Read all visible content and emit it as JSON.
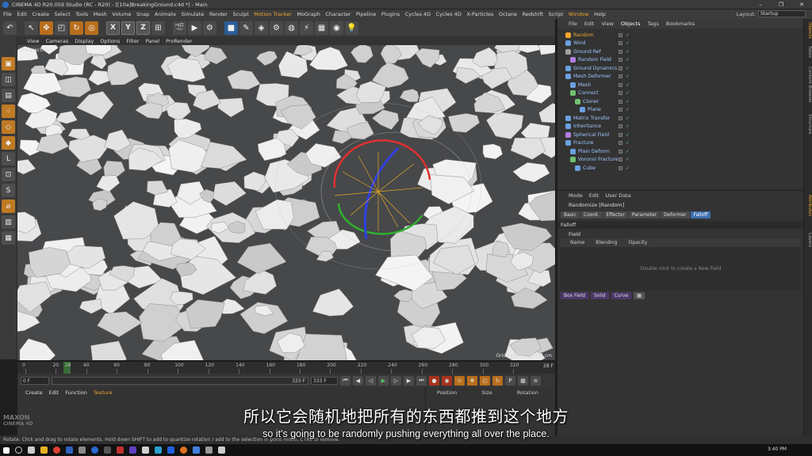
{
  "window": {
    "title": "CINEMA 4D R20.059 Studio (RC - R20) - [[10a]BreakingGround.c4d *] - Main",
    "controls": [
      "–",
      "❐",
      "✕"
    ]
  },
  "menubar": {
    "items": [
      "File",
      "Edit",
      "Create",
      "Select",
      "Tools",
      "Mesh",
      "Volume",
      "Snap",
      "Animate",
      "Simulate",
      "Render",
      "Sculpt",
      "Motion Tracker",
      "MoGraph",
      "Character",
      "Pipeline",
      "Plugins",
      "Cycles 4D",
      "Cycles 4D",
      "X-Particles",
      "Octane",
      "Redshift",
      "Script",
      "Window",
      "Help"
    ],
    "highlighted": [
      "Motion Tracker",
      "Window"
    ],
    "layout_label": "Layout:",
    "layout_value": "Startup"
  },
  "toolbar": {
    "axis_letters": [
      "X",
      "Y",
      "Z"
    ]
  },
  "viewport": {
    "menu": [
      "View",
      "Cameras",
      "Display",
      "Options",
      "Filter",
      "Panel",
      "ProRender"
    ],
    "projection": "Perspective",
    "grid_spacing": "Grid Spacing : 1000 cm"
  },
  "timeline": {
    "ticks": [
      "0",
      "20",
      "28",
      "40",
      "60",
      "80",
      "100",
      "120",
      "140",
      "160",
      "180",
      "200",
      "220",
      "240",
      "260",
      "280",
      "300",
      "320"
    ],
    "end_frame": "28 F",
    "current_frame": "0 F",
    "start_field": "0 F",
    "preview_end": "333 F",
    "end_field": "333 F"
  },
  "material_panel": {
    "menu": [
      "Create",
      "Edit",
      "Function",
      "Texture"
    ],
    "active": "Texture"
  },
  "coord_panel": {
    "headers": [
      "Position",
      "Size",
      "Rotation"
    ]
  },
  "object_manager": {
    "menu": [
      "File",
      "Edit",
      "View",
      "Objects",
      "Tags",
      "Bookmarks"
    ],
    "active_menu": "Objects",
    "objects": [
      {
        "name": "Random",
        "indent": 1,
        "color": "#f0a530",
        "selected": true
      },
      {
        "name": "Wind",
        "indent": 1,
        "color": "#6aa0e0"
      },
      {
        "name": "Ground Ref",
        "indent": 1,
        "color": "#a0a0a0"
      },
      {
        "name": "Random Field",
        "indent": 2,
        "color": "#b080e0"
      },
      {
        "name": "Ground Dynamics",
        "indent": 1,
        "color": "#6aa0e0"
      },
      {
        "name": "Mesh Deformer",
        "indent": 1,
        "color": "#6aa0e0"
      },
      {
        "name": "Mesh",
        "indent": 2,
        "color": "#6aa0e0"
      },
      {
        "name": "Connect",
        "indent": 2,
        "color": "#70c070"
      },
      {
        "name": "Cloner",
        "indent": 3,
        "color": "#70c070"
      },
      {
        "name": "Plane",
        "indent": 4,
        "color": "#6aa0e0"
      },
      {
        "name": "Matrix Transfer",
        "indent": 1,
        "color": "#6aa0e0"
      },
      {
        "name": "Inheritance",
        "indent": 1,
        "color": "#6aa0e0"
      },
      {
        "name": "Spherical Field",
        "indent": 1,
        "color": "#b080e0"
      },
      {
        "name": "Fracture",
        "indent": 1,
        "color": "#6aa0e0"
      },
      {
        "name": "Plain Deform",
        "indent": 2,
        "color": "#6aa0e0"
      },
      {
        "name": "Voronoi Fracture",
        "indent": 2,
        "color": "#70c070"
      },
      {
        "name": "Cube",
        "indent": 3,
        "color": "#6aa0e0"
      }
    ]
  },
  "attribute_manager": {
    "menu": [
      "Mode",
      "Edit",
      "User Data"
    ],
    "title": "Randomize [Random]",
    "tabs": [
      "Basic",
      "Coord.",
      "Effector",
      "Parameter",
      "Deformer",
      "Falloff"
    ],
    "active_tab": "Falloff",
    "section": "Falloff",
    "field_label": "Field",
    "columns": [
      "Name",
      "Blending",
      "Opacity"
    ],
    "empty_hint": "Double click to create a New Field",
    "buttons": [
      "Box Field",
      "Solid",
      "Curve"
    ]
  },
  "right_strip": [
    "Objects",
    "Takes",
    "Content Browser",
    "Structure",
    "Attributes",
    "Layers"
  ],
  "status": "Rotate: Click and drag to rotate elements. Hold down SHIFT to add to quantize rotation / add to the selection in point mode, CTRL to remove.",
  "subtitle": {
    "zh": "所以它会随机地把所有的东西都推到这个地方",
    "en": "so it's going to be randomly pushing everything all over the place."
  },
  "taskbar": {
    "clock": "3:40 PM"
  },
  "branding": {
    "line1": "MAXON",
    "line2": "CINEMA 4D"
  }
}
